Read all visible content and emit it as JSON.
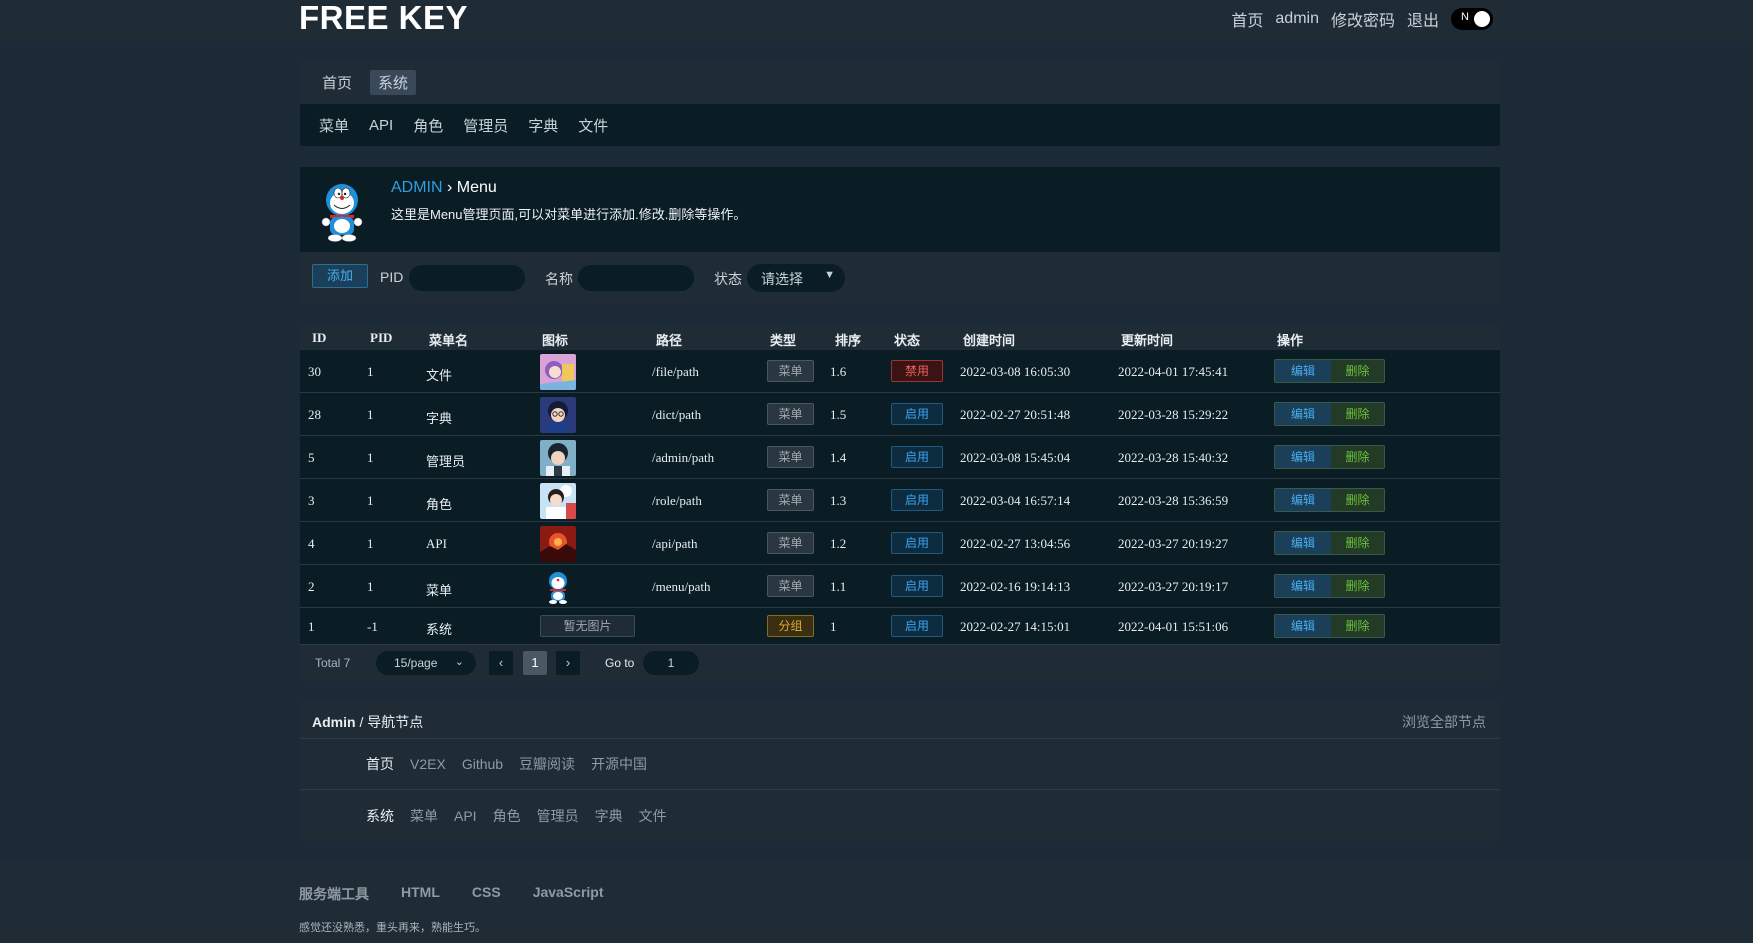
{
  "brand": "FREE KEY",
  "topnav": {
    "home": "首页",
    "user": "admin",
    "change_password": "修改密码",
    "logout": "退出",
    "theme_toggle": "N"
  },
  "breadcrumb": {
    "home": "首页",
    "system": "系统"
  },
  "subnav": [
    "菜单",
    "API",
    "角色",
    "管理员",
    "字典",
    "文件"
  ],
  "header": {
    "admin": "ADMIN",
    "sep": " › ",
    "page": "Menu",
    "desc": "这里是Menu管理页面,可以对菜单进行添加.修改.删除等操作。"
  },
  "filters": {
    "add": "添加",
    "pid_label": "PID",
    "name_label": "名称",
    "status_label": "状态",
    "status_value": "请选择"
  },
  "table": {
    "headers": [
      "ID",
      "PID",
      "菜单名",
      "图标",
      "路径",
      "类型",
      "排序",
      "状态",
      "创建时间",
      "更新时间",
      "操作"
    ],
    "rows": [
      {
        "id": "30",
        "pid": "1",
        "name": "文件",
        "icon": "anime-girl-icon",
        "path": "/file/path",
        "type": "菜单",
        "sort": "1.6",
        "status": "禁用",
        "created": "2022-03-08 16:05:30",
        "updated": "2022-04-01 17:45:41"
      },
      {
        "id": "28",
        "pid": "1",
        "name": "字典",
        "icon": "detective-icon",
        "path": "/dict/path",
        "type": "菜单",
        "sort": "1.5",
        "status": "启用",
        "created": "2022-02-27 20:51:48",
        "updated": "2022-03-28 15:29:22"
      },
      {
        "id": "5",
        "pid": "1",
        "name": "管理员",
        "icon": "anime-boy-icon",
        "path": "/admin/path",
        "type": "菜单",
        "sort": "1.4",
        "status": "启用",
        "created": "2022-03-08 15:45:04",
        "updated": "2022-03-28 15:40:32"
      },
      {
        "id": "3",
        "pid": "1",
        "name": "角色",
        "icon": "sky-character-icon",
        "path": "/role/path",
        "type": "菜单",
        "sort": "1.3",
        "status": "启用",
        "created": "2022-03-04 16:57:14",
        "updated": "2022-03-28 15:36:59"
      },
      {
        "id": "4",
        "pid": "1",
        "name": "API",
        "icon": "red-landscape-icon",
        "path": "/api/path",
        "type": "菜单",
        "sort": "1.2",
        "status": "启用",
        "created": "2022-02-27 13:04:56",
        "updated": "2022-03-27 20:19:27"
      },
      {
        "id": "2",
        "pid": "1",
        "name": "菜单",
        "icon": "doraemon-icon",
        "path": "/menu/path",
        "type": "菜单",
        "sort": "1.1",
        "status": "启用",
        "created": "2022-02-16 19:14:13",
        "updated": "2022-03-27 20:19:17"
      },
      {
        "id": "1",
        "pid": "-1",
        "name": "系统",
        "icon": "暂无图片",
        "path": "",
        "type": "分组",
        "sort": "1",
        "status": "启用",
        "created": "2022-02-27 14:15:01",
        "updated": "2022-04-01 15:51:06"
      }
    ],
    "edit": "编辑",
    "delete": "删除"
  },
  "pager": {
    "total": "Total 7",
    "size": "15/page",
    "prev": "‹",
    "page": "1",
    "next": "›",
    "goto": "Go to",
    "goto_value": "1"
  },
  "links": {
    "title_bold": "Admin",
    "title_rest": " / 导航节点",
    "all": "浏览全部节点",
    "row1": [
      "首页",
      "V2EX",
      "Github",
      "豆瓣阅读",
      "开源中国"
    ],
    "row2": [
      "系统",
      "菜单",
      "API",
      "角色",
      "管理员",
      "字典",
      "文件"
    ]
  },
  "footer": {
    "links": [
      "服务端工具",
      "HTML",
      "CSS",
      "JavaScript"
    ],
    "note": "感觉还没熟悉，重头再来，熟能生巧。"
  },
  "colors": {
    "accent": "#2f9ee0",
    "bg": "#1b2a36",
    "panel": "#1f2b35",
    "dark": "#0a1d24",
    "danger": "#f06060",
    "success": "#68c23a"
  }
}
